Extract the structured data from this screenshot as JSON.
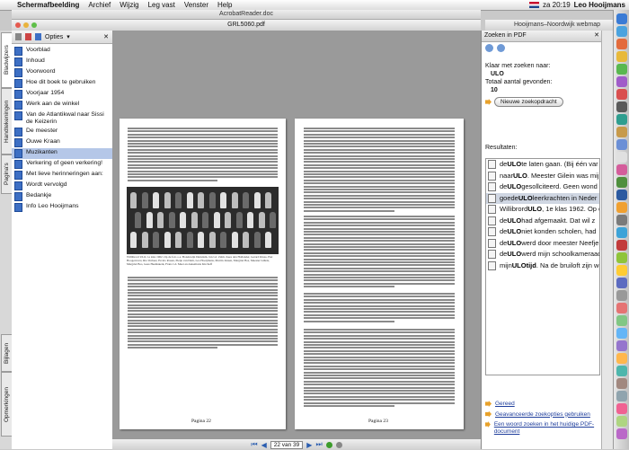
{
  "menubar": {
    "app": "Schermafbeelding",
    "items": [
      "Archief",
      "Wijzig",
      "Leg vast",
      "Venster",
      "Help"
    ],
    "time": "za 20:19",
    "user": "Leo Hooijmans"
  },
  "windows": {
    "back_title": "AcrobatReader.doc",
    "pdf_title": "GRL5060.pdf",
    "web_title": "Hooijmans–Noordwijk webmap"
  },
  "side_tabs": [
    "Bladwijzers",
    "Handtekeningen",
    "Pagina's",
    "Bijlagen",
    "Opmerkingen"
  ],
  "bookmarks": {
    "options_label": "Opties",
    "items": [
      "Voorblad",
      "Inhoud",
      "Voorwoord",
      "Hoe dit boek te gebruiken",
      "Voorjaar 1954",
      "Werk aan de winkel",
      "Van de Atlantikwal naar Sissi de Keizerin",
      "De meester",
      "Ouwe Kraan",
      "Muzikanten",
      "Verkering of geen verkering!",
      "Met lieve herinneringen aan:",
      "Wordt vervolgd",
      "Bedankje",
      "Info Leo Hooijmans"
    ],
    "selected_index": 9
  },
  "pdf": {
    "left_page_number": "Pagina 22",
    "right_page_number": "Pagina 23",
    "caption": "Willibrord ULO, 1e klas 1962. Op de foto o.a. Bondewijn Duindam, Jan v.d. Zalm, Kees den Hollander, Gerard Klaas, Piet Hoogervorst, Ria Verbeet, Ercalo Rosen, Pietje van Dam, Leo Hooijmans, Martin Jansen, Margriet Bos, Meester Gilleis, Margriet Bos, Gees Heemskerk, Frans v.d. Meer en Annemarie Kirchoff",
    "page_nav": "22 van 39"
  },
  "search": {
    "header": "Zoeken in PDF",
    "finished_label": "Klaar met zoeken naar:",
    "term": "ULO",
    "total_label": "Totaal aantal gevonden:",
    "total": "10",
    "new_search": "Nieuwe zoekopdracht",
    "results_label": "Resultaten:",
    "results": [
      {
        "pre": "de ",
        "hit": "ULO",
        "post": " te laten gaan. (Bij één var"
      },
      {
        "pre": "naar ",
        "hit": "ULO",
        "post": ". Meester Gilein was mijn"
      },
      {
        "pre": "de ",
        "hit": "ULO",
        "post": " gesollciteerd. Geen wond"
      },
      {
        "pre": "goede ",
        "hit": "ULO",
        "post": " leerkrachten in Neder"
      },
      {
        "pre": "Willibrord ",
        "hit": "ULO",
        "post": ", 1e klas 1962. Op de"
      },
      {
        "pre": "de ",
        "hit": "ULO",
        "post": " had afgemaakt. Dat wil z"
      },
      {
        "pre": "de ",
        "hit": "ULO",
        "post": " niet konden scholen, had"
      },
      {
        "pre": "de ",
        "hit": "ULO",
        "post": " werd door meester Neefje"
      },
      {
        "pre": "de ",
        "hit": "ULO",
        "post": " werd mijn schoolkameraad"
      },
      {
        "pre": "mijn ",
        "hit": "ULOtijd",
        "post": ". Na de bruiloft zijn we"
      }
    ],
    "selected_result": 3,
    "links": [
      "Gereed",
      "Geavanceerde zoekopties gebruiken",
      "Een woord zoeken in het huidige PDF-document"
    ]
  }
}
